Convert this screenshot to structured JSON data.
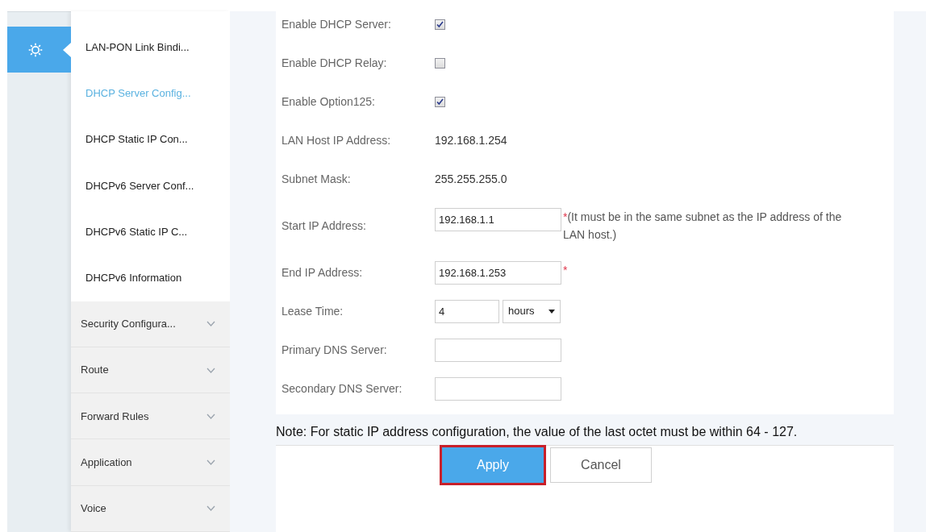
{
  "rail": {
    "items": [
      {
        "kind": "settings",
        "selected": true
      }
    ]
  },
  "submenu": {
    "items": [
      {
        "label": "LAN-PON Link Bindi...",
        "selected": false
      },
      {
        "label": "DHCP Server Config...",
        "selected": true
      },
      {
        "label": "DHCP Static IP Con...",
        "selected": false
      },
      {
        "label": "DHCPv6 Server Conf...",
        "selected": false
      },
      {
        "label": "DHCPv6 Static IP C...",
        "selected": false
      },
      {
        "label": "DHCPv6 Information",
        "selected": false
      }
    ],
    "sections": [
      {
        "label": "Security Configura...",
        "expanded": false
      },
      {
        "label": "Route",
        "expanded": false
      },
      {
        "label": "Forward Rules",
        "expanded": false
      },
      {
        "label": "Application",
        "expanded": false
      },
      {
        "label": "Voice",
        "expanded": false
      }
    ]
  },
  "form": {
    "rows": [
      {
        "kind": "checkbox",
        "label": "Enable DHCP Server:",
        "checked": true
      },
      {
        "kind": "checkbox",
        "label": "Enable DHCP Relay:",
        "checked": false
      },
      {
        "kind": "checkbox",
        "label": "Enable Option125:",
        "checked": true
      },
      {
        "kind": "text",
        "label": "LAN Host IP Address:",
        "value": "192.168.1.254"
      },
      {
        "kind": "text",
        "label": "Subnet Mask:",
        "value": "255.255.255.0"
      },
      {
        "kind": "input",
        "label": "Start IP Address:",
        "value": "192.168.1.1",
        "hint": "(It must be in the same subnet as the IP address of the LAN host.)",
        "mark": "*"
      },
      {
        "kind": "input",
        "label": "End IP Address:",
        "value": "192.168.1.253",
        "mark": "*"
      },
      {
        "kind": "duration",
        "label": "Lease Time:",
        "value": "4",
        "unit": "hours"
      },
      {
        "kind": "input",
        "label": "Primary DNS Server:",
        "value": ""
      },
      {
        "kind": "input",
        "label": "Secondary DNS Server:",
        "value": ""
      }
    ]
  },
  "note": "Note: For static IP address configuration, the value of the last octet must be within 64 - 127.",
  "buttons": [
    {
      "label": "Apply",
      "kind": "primary",
      "highlighted": true
    },
    {
      "label": "Cancel",
      "kind": "secondary",
      "highlighted": false
    }
  ]
}
